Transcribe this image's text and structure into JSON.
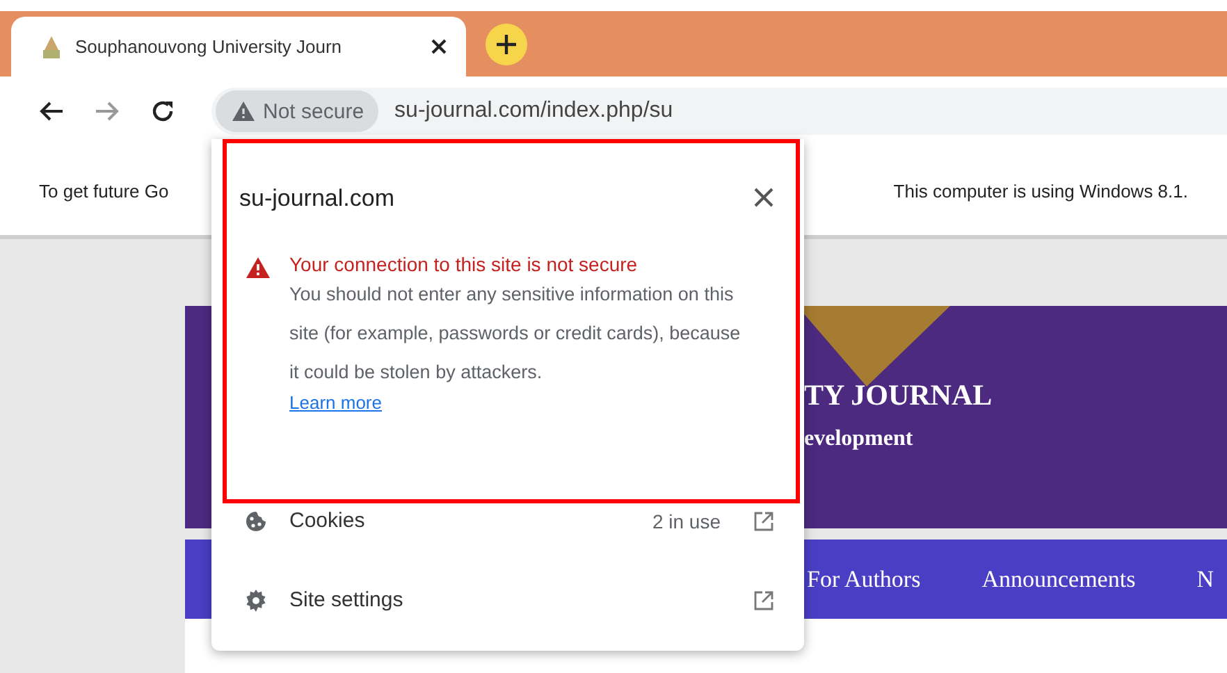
{
  "browser": {
    "tab": {
      "title": "Souphanouvong University Journ",
      "selected": true
    },
    "address": {
      "security_chip": "Not secure",
      "url": "su-journal.com/index.php/su"
    }
  },
  "info_bar": {
    "text_left": "To get future Go",
    "text_right": "This computer is using Windows 8.1."
  },
  "page": {
    "banner": {
      "title": "TY JOURNAL",
      "subtitle": "evelopment"
    },
    "nav": [
      "For Authors",
      "Announcements",
      "N"
    ]
  },
  "site_popup": {
    "domain": "su-journal.com",
    "warning": {
      "heading": "Your connection to this site is not secure",
      "body": "You should not enter any sensitive information on this site (for example, passwords or credit cards), because it could be stolen by attackers.",
      "link": "Learn more"
    },
    "rows": [
      {
        "kind": "cookies",
        "label": "Cookies",
        "value": "2 in use"
      },
      {
        "kind": "settings",
        "label": "Site settings"
      }
    ]
  }
}
